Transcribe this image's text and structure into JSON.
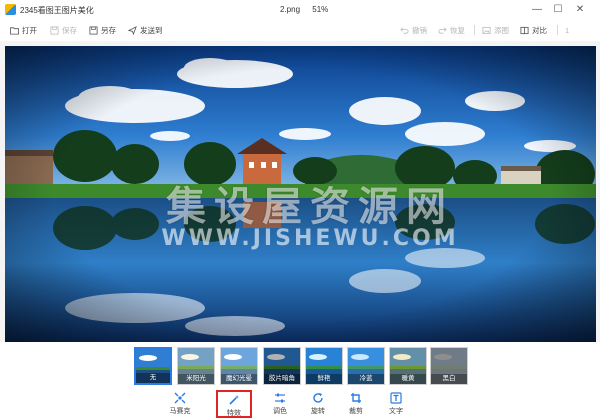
{
  "app": {
    "title": "2345看图王图片美化",
    "file_name": "2.png",
    "zoom": "51%"
  },
  "window_controls": {
    "minimize": "—",
    "maximize": "☐",
    "close": "✕"
  },
  "toolbar": {
    "open": "打开",
    "save": "保存",
    "save_as": "另存",
    "send_to": "发送到",
    "undo": "撤销",
    "redo": "恢复",
    "add_image": "添图",
    "compare": "对比",
    "sep_label": "1"
  },
  "watermark": {
    "text_cn": "集设屋资源网",
    "text_en": "WWW.JISHEWU.COM"
  },
  "filters": [
    {
      "label": "无",
      "active": true,
      "tint": "#000000",
      "tint_alpha": 0
    },
    {
      "label": "米阳光",
      "active": false,
      "tint": "#f3e6b0",
      "tint_alpha": 0.35
    },
    {
      "label": "魔幻光晕",
      "active": false,
      "tint": "#ffffff",
      "tint_alpha": 0.3
    },
    {
      "label": "胶片暗角",
      "active": false,
      "tint": "#000000",
      "tint_alpha": 0.3
    },
    {
      "label": "鲜艳",
      "active": false,
      "tint": "#00a0ff",
      "tint_alpha": 0.15
    },
    {
      "label": "冷蓝",
      "active": false,
      "tint": "#4fb5ff",
      "tint_alpha": 0.3
    },
    {
      "label": "暖黄",
      "active": false,
      "tint": "#d9b84a",
      "tint_alpha": 0.3
    },
    {
      "label": "黑白",
      "active": false,
      "tint": "#808080",
      "tint_alpha": 1
    }
  ],
  "tools": {
    "magic_wand": "马赛克",
    "effects": "特效",
    "adjust": "调色",
    "rotate": "旋转",
    "crop": "裁剪",
    "text": "文字"
  },
  "colors": {
    "accent": "#2b7be4",
    "highlight": "#e02424"
  }
}
